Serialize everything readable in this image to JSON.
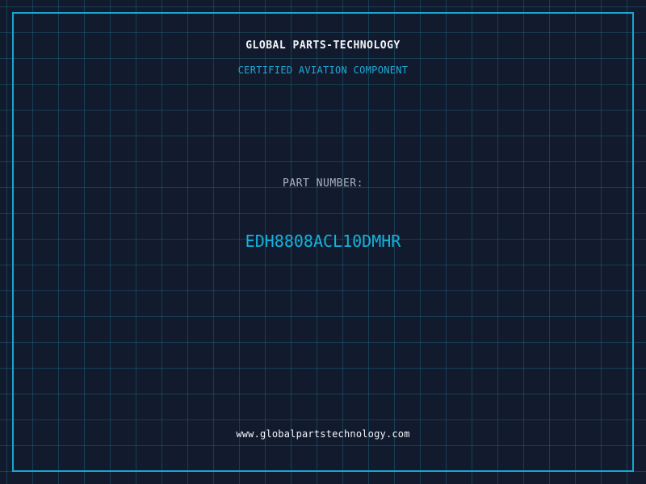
{
  "header": {
    "company": "GLOBAL PARTS-TECHNOLOGY",
    "subtitle": "CERTIFIED AVIATION COMPONENT"
  },
  "part": {
    "label": "PART NUMBER:",
    "number": "EDH8808ACL10DMHR"
  },
  "footer": {
    "website": "www.globalpartstechnology.com"
  },
  "colors": {
    "background": "#121b2e",
    "grid": "#1e6f86",
    "accent": "#14b2dc",
    "text": "#f1f4f8",
    "muted": "#a9b3c2"
  }
}
